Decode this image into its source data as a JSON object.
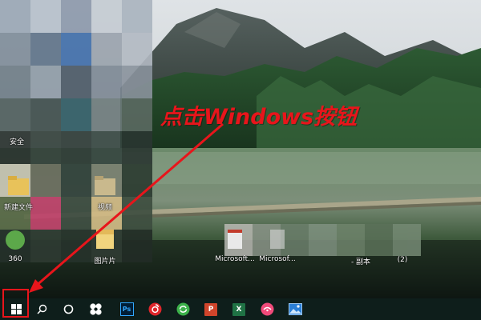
{
  "annotation": {
    "text": "点击Windows按钮",
    "color": "#e8151b"
  },
  "desktop": {
    "icons": [
      {
        "name": "desktop-icon-1",
        "label": "安全"
      },
      {
        "name": "desktop-icon-new-file",
        "label": "新建文件"
      },
      {
        "name": "desktop-icon-video",
        "label": "视频"
      },
      {
        "name": "desktop-icon-360",
        "label": "360"
      },
      {
        "name": "desktop-icon-picture",
        "label": "图片片"
      },
      {
        "name": "desktop-icon-microsoft-1",
        "label": "Microsoft..."
      },
      {
        "name": "desktop-icon-microsoft-2",
        "label": "Microsof..."
      },
      {
        "name": "desktop-icon-script",
        "label": "- 副本"
      },
      {
        "name": "desktop-icon-count",
        "label": "(2)"
      }
    ]
  },
  "taskbar": {
    "items": [
      {
        "name": "start-button",
        "icon": "windows-logo-icon"
      },
      {
        "name": "search-button",
        "icon": "search-icon"
      },
      {
        "name": "cortana-button",
        "icon": "cortana-circle-icon"
      },
      {
        "name": "app-pinwheel",
        "icon": "pinwheel-icon"
      },
      {
        "name": "app-photoshop",
        "icon": "photoshop-icon",
        "text": "Ps"
      },
      {
        "name": "app-netease-music",
        "icon": "netease-music-icon"
      },
      {
        "name": "app-green-refresh",
        "icon": "green-refresh-icon"
      },
      {
        "name": "app-powerpoint",
        "icon": "powerpoint-icon",
        "text": "P"
      },
      {
        "name": "app-excel",
        "icon": "excel-icon",
        "text": "X"
      },
      {
        "name": "app-pink-chat",
        "icon": "pink-chat-icon"
      },
      {
        "name": "app-photos",
        "icon": "photos-icon"
      }
    ]
  },
  "colors": {
    "taskbar_bg": "#0e1e1b",
    "highlight": "#e8151b"
  }
}
